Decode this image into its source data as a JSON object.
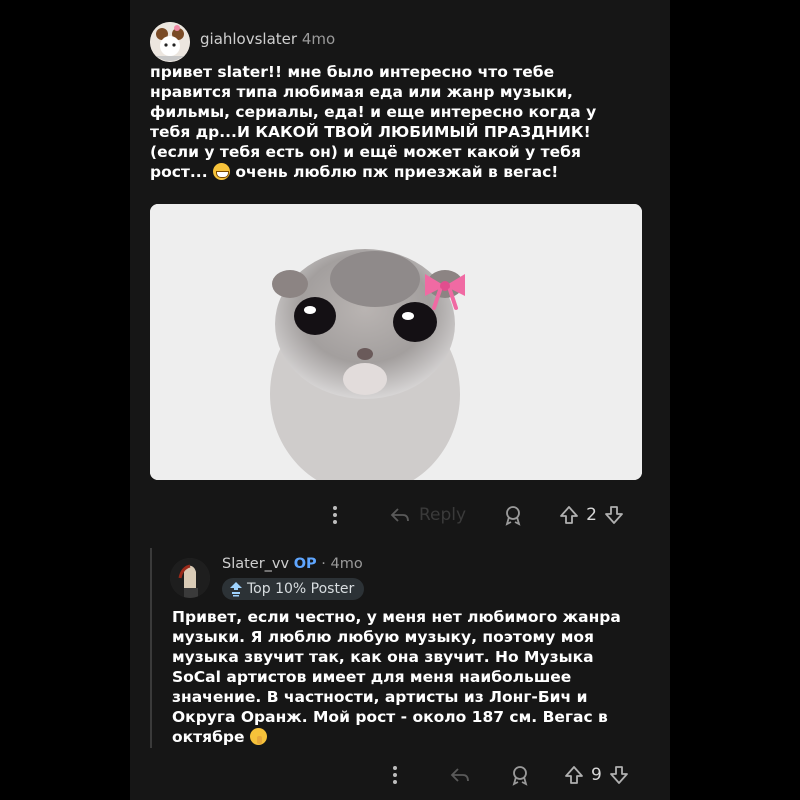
{
  "post": {
    "username": "giahlovslater",
    "time": "4mo",
    "body": "привет slater!! мне было интересно что тебе нравится типа любимая еда или жанр музыки, фильмы, сериалы, еда! и еще интересно когда у тебя др...И КАКОЙ ТВОЙ ЛЮБИМЫЙ ПРАЗДНИК! (если у тебя есть он) и ещё может какой у тебя рост...",
    "body_end": "очень люблю пж приезжай в вегас!",
    "reply_label": "Reply",
    "vote_count": "2"
  },
  "reply": {
    "username": "Slater_vv",
    "op_label": "OP",
    "separator": "·",
    "time": "4mo",
    "badge": "Top 10% Poster",
    "body": "Привет, если честно, у меня нет любимого жанра музыки. Я люблю любую музыку, поэтому моя музыка звучит так, как она звучит. Но Музыка SoCal артистов имеет для меня наибольшее значение. В частности, артисты из Лонг-Бич и Округа Оранж. Мой рост - около 187 см. Вегас в октябре",
    "vote_count": "9"
  },
  "icons": [
    "more-icon",
    "reply-icon",
    "award-icon",
    "upvote-icon",
    "downvote-icon",
    "grin-emoji-icon",
    "shush-emoji-icon",
    "badge-icon"
  ],
  "colors": {
    "background": "#161616",
    "op": "#5fa6ff",
    "badge_bg": "#2c3236"
  }
}
